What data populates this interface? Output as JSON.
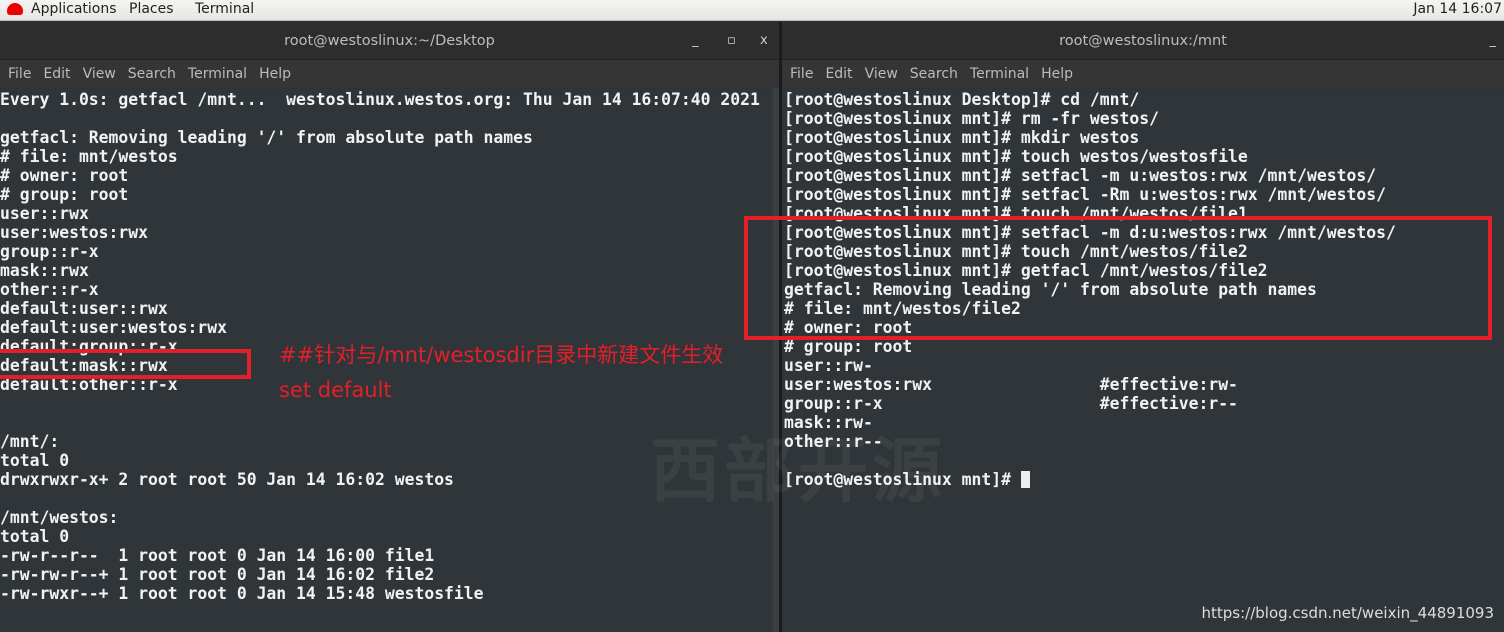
{
  "topbar": {
    "applications": "Applications",
    "places": "Places",
    "terminal": "Terminal",
    "clock": "Jan 14 16:07"
  },
  "left": {
    "title": "root@westoslinux:~/Desktop",
    "controls": {
      "minimize": "_",
      "maximize": "▫",
      "close": "x"
    },
    "menu": [
      "File",
      "Edit",
      "View",
      "Search",
      "Terminal",
      "Help"
    ],
    "lines": [
      "Every 1.0s: getfacl /mnt...  westoslinux.westos.org: Thu Jan 14 16:07:40 2021",
      "",
      "getfacl: Removing leading '/' from absolute path names",
      "# file: mnt/westos",
      "# owner: root",
      "# group: root",
      "user::rwx",
      "user:westos:rwx",
      "group::r-x",
      "mask::rwx",
      "other::r-x",
      "default:user::rwx",
      "default:user:westos:rwx",
      "default:group::r-x",
      "default:mask::rwx",
      "default:other::r-x",
      "",
      "",
      "/mnt/:",
      "total 0",
      "drwxrwxr-x+ 2 root root 50 Jan 14 16:02 westos",
      "",
      "/mnt/westos:",
      "total 0",
      "-rw-r--r--  1 root root 0 Jan 14 16:00 file1",
      "-rw-rw-r--+ 1 root root 0 Jan 14 16:02 file2",
      "-rw-rwxr--+ 1 root root 0 Jan 14 15:48 westosfile"
    ]
  },
  "right": {
    "title": "root@westoslinux:/mnt",
    "controls": {
      "minimize": "_"
    },
    "menu": [
      "File",
      "Edit",
      "View",
      "Search",
      "Terminal",
      "Help"
    ],
    "lines": [
      "[root@westoslinux Desktop]# cd /mnt/",
      "[root@westoslinux mnt]# rm -fr westos/",
      "[root@westoslinux mnt]# mkdir westos",
      "[root@westoslinux mnt]# touch westos/westosfile",
      "[root@westoslinux mnt]# setfacl -m u:westos:rwx /mnt/westos/",
      "[root@westoslinux mnt]# setfacl -Rm u:westos:rwx /mnt/westos/",
      "[root@westoslinux mnt]# touch /mnt/westos/file1",
      "[root@westoslinux mnt]# setfacl -m d:u:westos:rwx /mnt/westos/",
      "[root@westoslinux mnt]# touch /mnt/westos/file2",
      "[root@westoslinux mnt]# getfacl /mnt/westos/file2",
      "getfacl: Removing leading '/' from absolute path names",
      "# file: mnt/westos/file2",
      "# owner: root",
      "# group: root",
      "user::rw-",
      "user:westos:rwx                 #effective:rw-",
      "group::r-x                      #effective:r--",
      "mask::rw-",
      "other::r--",
      "",
      "[root@westoslinux mnt]# "
    ]
  },
  "annotation": {
    "line1": "##针对与/mnt/westosdir目录中新建文件生效",
    "line2": "set default"
  },
  "watermark": "西部开源",
  "source_url": "https://blog.csdn.net/weixin_44891093",
  "colors": {
    "highlight": "#e3202a",
    "terminal_bg": "#2f3538"
  }
}
